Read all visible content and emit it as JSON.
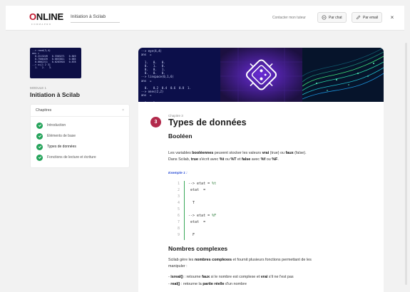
{
  "header": {
    "logo_main": "NLINE",
    "logo_o": "O",
    "logo_sub": "FORMAPRO",
    "course_title": "Initiation à Scilab",
    "contact_label": "Contacter mon tuteur",
    "chat_label": "Par chat",
    "email_label": "Par email",
    "close_label": "×"
  },
  "sidebar": {
    "module_label": "MODULE 1",
    "module_title": "Initiation à Scilab",
    "chapters_title": "Chapitres",
    "chapters_close": "×",
    "chapters": [
      {
        "label": "Introduction"
      },
      {
        "label": "Eléments de base"
      },
      {
        "label": "Types de données"
      },
      {
        "label": "Fonctions de lecture et écriture"
      }
    ],
    "thumb_code": "--> rand(3,4)\nans =\n  0.2113249   0.3303271   0.849\n  0.7560439   0.6653811   0.685\n  0.0002211   0.6283918   0.878\n--> x=[1 2 3]\n  1.   2.   3."
  },
  "main": {
    "banner_code": "--> eye(4,4)\nans  =\n\n  1.   0.   0.\n  0.   1.   0.\n  0.   0.   1.\n  0.   0.   0.\n--> linspace(0,1,6)\nans  =\n\n  0.   0.2  0.4  0.6  0.8  1.\n--> ones(2,2)\nans  =\n\n  1.   1.\n  1.   1.",
    "chapter_number": "3",
    "chapter_label": "Chapitre 3",
    "chapter_title": "Types de données",
    "section1_title": "Booléen",
    "para1_a": "Les variables ",
    "para1_b": "booléennes",
    "para1_c": " peuvent stocker les valeurs ",
    "para1_d": "vrai",
    "para1_e": " (true) ou ",
    "para1_f": "faux",
    "para1_g": " (false).",
    "para2_a": "Dans Scilab, ",
    "para2_b": "true",
    "para2_c": " s'écrit avec ",
    "para2_d": "%t",
    "para2_e": " ou ",
    "para2_f": "%T",
    "para2_g": " et ",
    "para2_h": "false",
    "para2_i": " avec ",
    "para2_j": "%f",
    "para2_k": " ou ",
    "para2_l": "%F",
    "para2_m": ".",
    "example_label": "Exemple 1 :",
    "code_lines": [
      {
        "n": "1",
        "t": "--> etat = %t"
      },
      {
        "n": "2",
        "t": " etat  ="
      },
      {
        "n": "3",
        "t": ""
      },
      {
        "n": "4",
        "t": "  T"
      },
      {
        "n": "5",
        "t": ""
      },
      {
        "n": "6",
        "t": "--> etat = %F"
      },
      {
        "n": "7",
        "t": " etat  ="
      },
      {
        "n": "8",
        "t": ""
      },
      {
        "n": "9",
        "t": "  F"
      }
    ],
    "section2_title": "Nombres complexes",
    "para3_a": "Scilab gère les ",
    "para3_b": "nombres complexes",
    "para3_c": " et fournit plusieurs fonctions permettant de les",
    "para3_d": "manipuler :",
    "bullet1_a": "- ",
    "bullet1_b": "isreal()",
    "bullet1_c": " : retourne ",
    "bullet1_d": "faux",
    "bullet1_e": " si le nombre est complexe et ",
    "bullet1_f": "vrai",
    "bullet1_g": " s'il ne l'est pas",
    "bullet2_a": "- ",
    "bullet2_b": "real()",
    "bullet2_c": " : retourne la ",
    "bullet2_d": "partie réelle",
    "bullet2_e": " d'un nombre"
  },
  "colors": {
    "accent": "#b22a4c",
    "brand_red": "#c0152c",
    "check_green": "#24a35a",
    "example_blue": "#2c4fd6"
  }
}
